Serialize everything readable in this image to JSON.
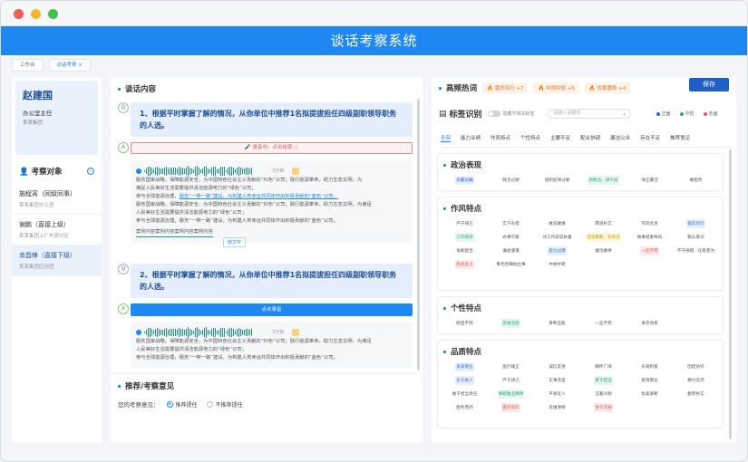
{
  "app": {
    "title": "谈话考察系统"
  },
  "tabs": [
    "工作台",
    "谈话考察 ×"
  ],
  "employee": {
    "name": "赵建国",
    "position": "办公室主任",
    "org": "某某集团"
  },
  "objects": {
    "title": "考察对象",
    "people": [
      {
        "name": "施程宵（同级同事）",
        "org": "某某集团办公室"
      },
      {
        "name": "谢鹏（直接上级）",
        "org": "某某集团上广东研讨区"
      },
      {
        "name": "余昌锋（直接下级）",
        "org": "某某集团应用团"
      }
    ]
  },
  "interview": {
    "title": "谈话内容",
    "q1": {
      "badge": "Q",
      "text": "1、根据平时掌握了解的情况，从你单位中推荐1名拟提拔担任四级副职领导职务的人选。"
    },
    "a1": {
      "badge": "A",
      "status": "录音中，点击结束 ○"
    },
    "p1": {
      "time": "3分钟",
      "l1": "服务国家战略，保障能源安全，为中国特色社会主义贡献的“红色”公司；践行能源革命，助力生态文明，为",
      "l2": "满足人民美好生活需要提供清洁能源电力的“绿色”公司；",
      "l3a": "参与全球能源治理，",
      "l3b": "服务“一带一路”建设，为构建人类命运共同体作出积极贡献的“蓝色”公司。",
      "l4": "服务国家战略，保障能源安全，为中国特色社会主义贡献的“红色”公司；践行能源革命，助力生态文明，为满足",
      "l5": "人民美好生活需要提供清洁能源电力的“绿色”公司；",
      "l6": "参与全球能源治理，服务“一带一路”建设，为构建人类命运共同体作出积极贡献的“蓝色”公司。",
      "l7": "案例内容案例内容案例内容案例内容",
      "tip": "转文字"
    },
    "q2": {
      "badge": "Q",
      "text": "2、根据平时掌握了解的情况，从你单位中推荐1名拟提拔担任四级副职领导职务的人选。"
    },
    "a2": {
      "badge": "A",
      "button": "点击录音"
    },
    "p2": {
      "time": "3分钟",
      "l1": "服务国家战略，保障能源安全，为中国特色社会主义贡献的“红色”公司；践行能源革命，助力生态文明，为满足",
      "l2": "人民美好生活需要提供清洁能源电力的“绿色”公司；",
      "l3": "参与全球能源治理，服务“一带一路”建设，为构建人类命运共同体作出积极贡献的“蓝色”公司。"
    }
  },
  "opinion": {
    "title": "推荐/考察意见",
    "label": "您的考察意见：",
    "opt1": "推荐提任",
    "opt2": "不推荐提任"
  },
  "hot": {
    "title": "高频热词",
    "words": [
      "🔥 雷厉风行 +7",
      "🔥 中规中矩 +5",
      "🔥 优柔寡断 +4"
    ],
    "save": "保存"
  },
  "tagging": {
    "title": "标签识别",
    "toggle": "隐藏不相关标签",
    "search_placeholder": "请输入关键字",
    "legend": [
      "正面",
      "中性",
      "负面"
    ],
    "legend_colors": [
      "#2a67d9",
      "#2ea97a",
      "#e05555"
    ],
    "filters": [
      "全部",
      "能力业绩",
      "作风特点",
      "个性特点",
      "主要不足",
      "配合协调",
      "廉洁公众",
      "存在不足",
      "推荐意见"
    ]
  },
  "categories": [
    {
      "title": "政治表现",
      "tags": [
        [
          "高瞻远瞩",
          "b"
        ],
        [
          "政治过硬",
          ""
        ],
        [
          "组织纪律过硬",
          ""
        ],
        [
          "讲政治、讲大局",
          "g"
        ],
        [
          "清正廉洁",
          ""
        ],
        [
          "敢担责",
          ""
        ]
      ]
    },
    {
      "title": "作风特点",
      "tags": [
        [
          "严于律己",
          ""
        ],
        [
          "实干肯担",
          ""
        ],
        [
          "敢说敢做",
          ""
        ],
        [
          "厚道朴实",
          ""
        ],
        [
          "作风优良",
          ""
        ],
        [
          "雷厉风行",
          "b"
        ],
        [
          "工作高效",
          "g"
        ],
        [
          "办事可靠",
          ""
        ],
        [
          "对工作非常执着",
          ""
        ],
        [
          "说话算数、负责任",
          "y"
        ],
        [
          "做事结果导向",
          ""
        ],
        [
          "服从意识",
          ""
        ],
        [
          "协助配合",
          ""
        ],
        [
          "谦虚谨慎",
          ""
        ],
        [
          "能力过硬",
          "b"
        ],
        [
          "敢闯敢拼",
          ""
        ],
        [
          "一丝不苟",
          "r"
        ],
        [
          "不守规矩、任意妄为",
          ""
        ],
        [
          "形式主义",
          "r"
        ],
        [
          "事无巨细怕出事",
          ""
        ],
        [
          "中规中矩",
          ""
        ]
      ]
    },
    {
      "title": "个性特点",
      "tags": [
        [
          "刚直不阿",
          ""
        ],
        [
          "思维活跃",
          "g"
        ],
        [
          "果断坚毅",
          ""
        ],
        [
          "一丝不苟",
          ""
        ],
        [
          "讲究效率",
          ""
        ]
      ]
    },
    {
      "title": "品质特点",
      "tags": [
        [
          "爱岗敬业",
          "b"
        ],
        [
          "品行端正",
          ""
        ],
        [
          "诚信友善",
          ""
        ],
        [
          "胸怀广阔",
          ""
        ],
        [
          "乐观积极",
          ""
        ],
        [
          "团结协作",
          ""
        ],
        [
          "乐于助人",
          "b"
        ],
        [
          "严于律己",
          ""
        ],
        [
          "实事求是",
          ""
        ],
        [
          "勇于担当",
          "g"
        ],
        [
          "爱岗敬业",
          ""
        ],
        [
          "精力充沛",
          ""
        ],
        [
          "敢于担当责任",
          ""
        ],
        [
          "奉献敬业精神",
          "g"
        ],
        [
          "平易近人",
          ""
        ],
        [
          "沉着冷静",
          ""
        ],
        [
          "优柔寡断",
          ""
        ],
        [
          "勤劳朴实",
          ""
        ],
        [
          "服务周到",
          ""
        ],
        [
          "雷厉风行",
          "r"
        ],
        [
          "思维清晰",
          ""
        ],
        [
          "善于沟通",
          "r"
        ]
      ]
    }
  ]
}
